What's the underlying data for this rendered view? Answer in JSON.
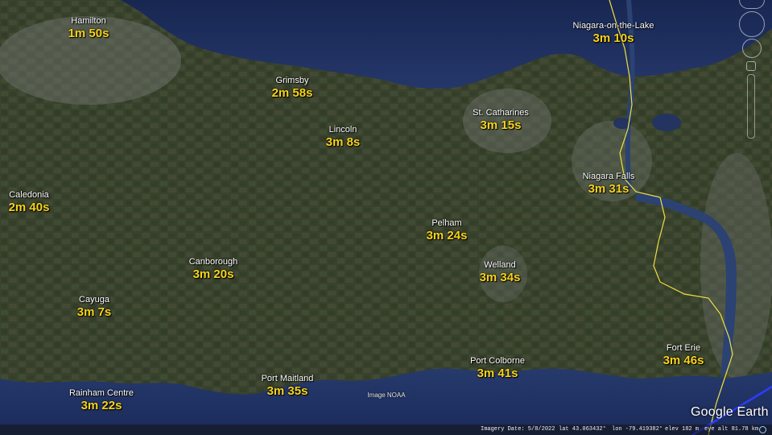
{
  "places": [
    {
      "id": "hamilton",
      "name": "Hamilton",
      "time": "1m 50s"
    },
    {
      "id": "grimsby",
      "name": "Grimsby",
      "time": "2m 58s"
    },
    {
      "id": "lincoln",
      "name": "Lincoln",
      "time": "3m 8s"
    },
    {
      "id": "st-catharines",
      "name": "St. Catharines",
      "time": "3m 15s"
    },
    {
      "id": "niagara-on-the-lake",
      "name": "Niagara-on-the-Lake",
      "time": "3m 10s"
    },
    {
      "id": "niagara-falls",
      "name": "Niagara Falls",
      "time": "3m 31s"
    },
    {
      "id": "caledonia",
      "name": "Caledonia",
      "time": "2m 40s"
    },
    {
      "id": "pelham",
      "name": "Pelham",
      "time": "3m 24s"
    },
    {
      "id": "canborough",
      "name": "Canborough",
      "time": "3m 20s"
    },
    {
      "id": "welland",
      "name": "Welland",
      "time": "3m 34s"
    },
    {
      "id": "cayuga",
      "name": "Cayuga",
      "time": "3m 7s"
    },
    {
      "id": "fort-erie",
      "name": "Fort Erie",
      "time": "3m 46s"
    },
    {
      "id": "port-colborne",
      "name": "Port Colborne",
      "time": "3m 41s"
    },
    {
      "id": "port-maitland",
      "name": "Port Maitland",
      "time": "3m 35s"
    },
    {
      "id": "rainham-centre",
      "name": "Rainham Centre",
      "time": "3m 22s"
    }
  ],
  "attribution": "Image NOAA",
  "logo": "Google Earth",
  "status": {
    "imagery_date": "Imagery Date: 5/8/2022",
    "lat": "lat   43.063432°",
    "lon": "lon  -79.419382°",
    "elev": "elev  182 m",
    "eye_alt": "eye alt  81.78 km"
  },
  "colors": {
    "time_label": "#f7d31a",
    "border_line": "#f0e040",
    "route_line": "#2b3dff",
    "water": "#1f2f5c"
  },
  "icons": [
    "compass-icon",
    "look-joystick-icon",
    "move-joystick-icon",
    "street-view-icon",
    "zoom-slider-icon",
    "status-indicator-icon"
  ]
}
